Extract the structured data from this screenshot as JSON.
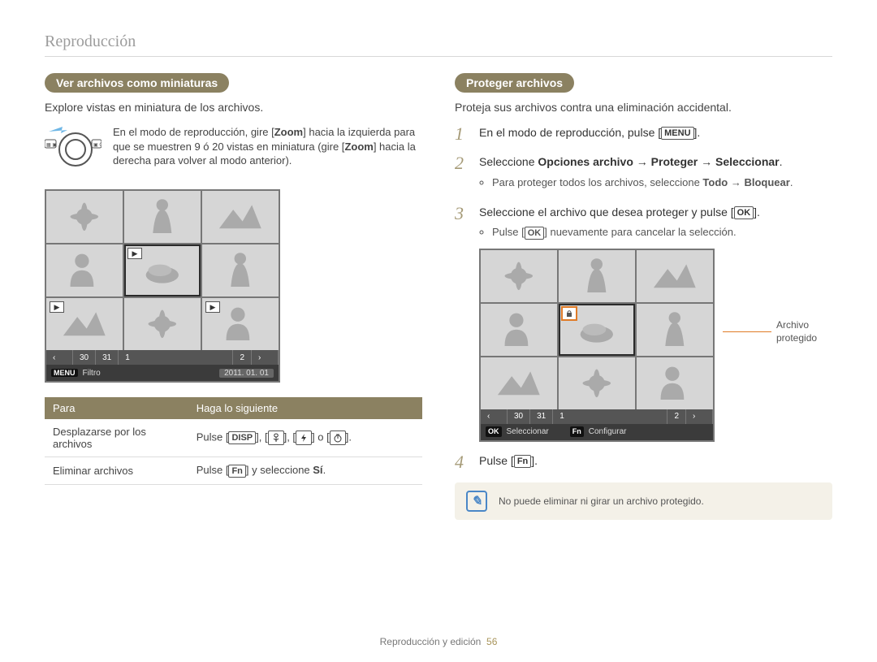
{
  "section_title": "Reproducción",
  "footer": {
    "text": "Reproducción y edición",
    "page": "56"
  },
  "left": {
    "heading": "Ver archivos como miniaturas",
    "lead": "Explore vistas en miniatura de los archivos.",
    "tip_pre": "En el modo de reproducción, gire [",
    "tip_zoom1": "Zoom",
    "tip_mid1": "] hacia la izquierda para que se muestren 9 ó 20 vistas en miniatura (gire [",
    "tip_zoom2": "Zoom",
    "tip_mid2": "] hacia la derecha para volver al modo anterior).",
    "scrub": {
      "a": "30",
      "b": "31",
      "c": "1",
      "d": "2"
    },
    "bar2": {
      "menu": "MENU",
      "filtro": "Filtro",
      "date": "2011. 01. 01"
    },
    "table": {
      "h1": "Para",
      "h2": "Haga lo siguiente",
      "r1c1": "Desplazarse por los archivos",
      "r1_pre": "Pulse [",
      "r1_disp": "DISP",
      "r1_sep": "], [",
      "r1_or": " o [",
      "r1_end": "].",
      "r2c1": "Eliminar archivos",
      "r2_pre": "Pulse [",
      "r2_fn": "Fn",
      "r2_mid": "] y seleccione ",
      "r2_si": "Sí",
      "r2_end": "."
    }
  },
  "right": {
    "heading": "Proteger archivos",
    "lead": "Proteja sus archivos contra una eliminación accidental.",
    "s1_pre": "En el modo de reproducción, pulse [",
    "s1_menu": "MENU",
    "s1_end": "].",
    "s2_pre": "Seleccione ",
    "s2_b1": "Opciones archivo",
    "s2_arrow": " → ",
    "s2_b2": "Proteger",
    "s2_b3": "Seleccionar",
    "s2_end": ".",
    "s2_sub_pre": "Para proteger todos los archivos, seleccione ",
    "s2_sub_b1": "Todo",
    "s2_sub_b2": "Bloquear",
    "s2_sub_end": ".",
    "s3_pre": "Seleccione el archivo que desea proteger y pulse [",
    "s3_ok": "OK",
    "s3_end": "].",
    "s3_sub_pre": "Pulse [",
    "s3_sub_ok": "OK",
    "s3_sub_end": "] nuevamente para cancelar la selección.",
    "callout": "Archivo protegido",
    "scrub": {
      "a": "30",
      "b": "31",
      "c": "1",
      "d": "2"
    },
    "bar2": {
      "ok": "OK",
      "sel": "Seleccionar",
      "fn": "Fn",
      "cfg": "Configurar"
    },
    "s4_pre": "Pulse [",
    "s4_fn": "Fn",
    "s4_end": "].",
    "note": "No puede eliminar ni girar un archivo protegido."
  }
}
